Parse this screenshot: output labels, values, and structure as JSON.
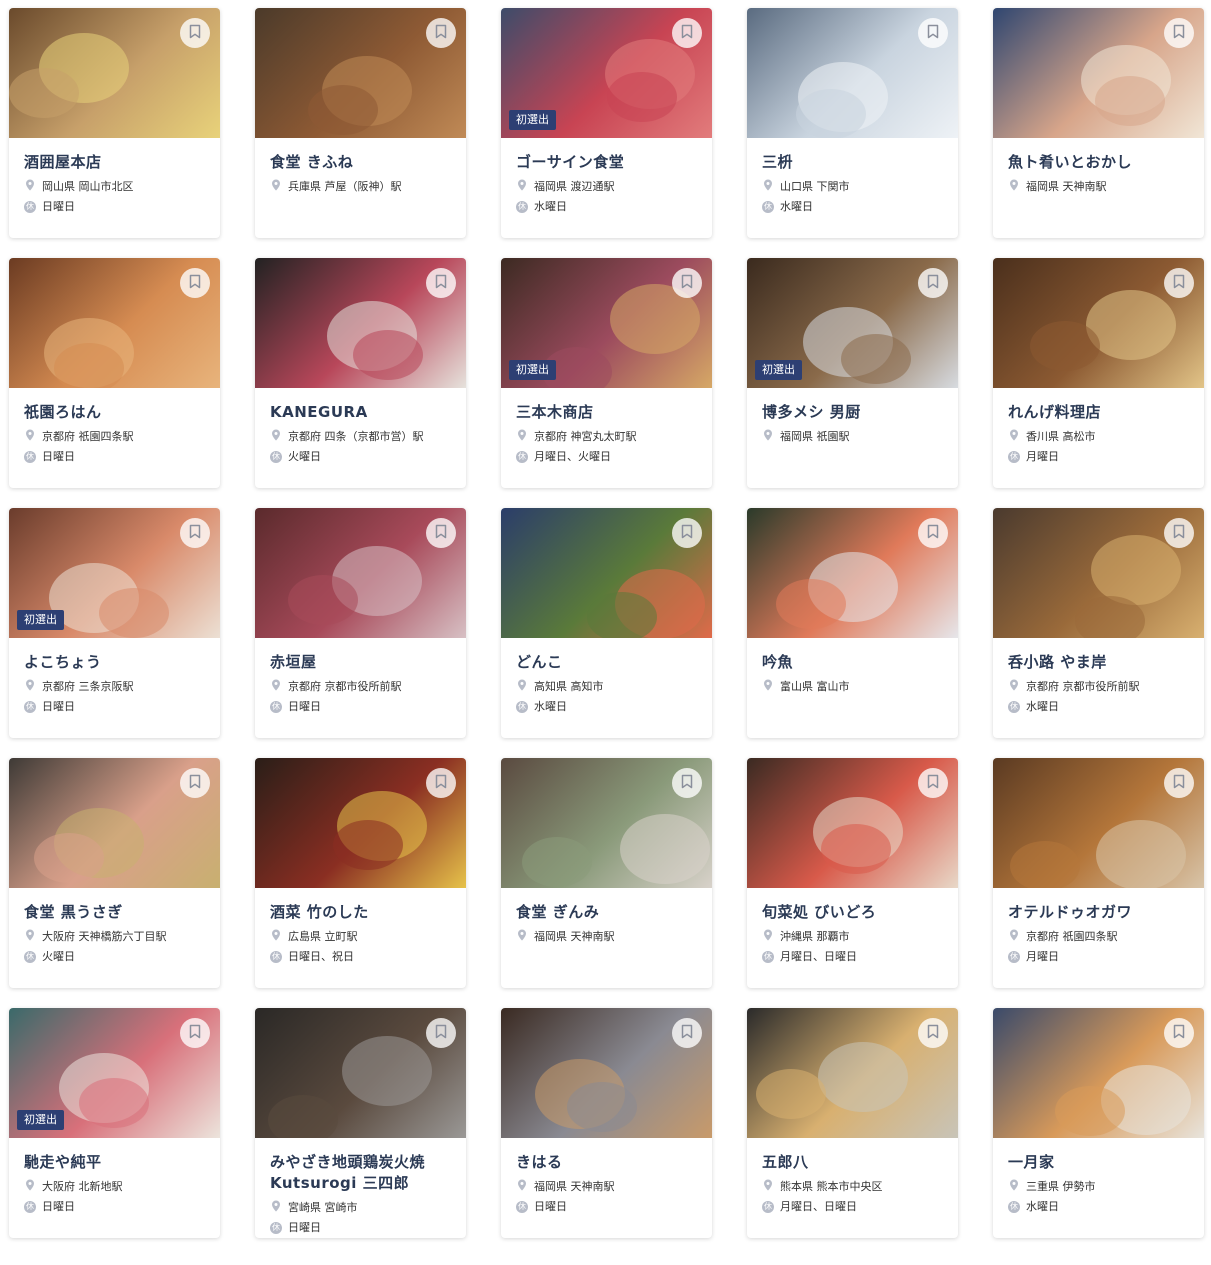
{
  "badge_label": "初選出",
  "restaurants": [
    {
      "name": "酒囲屋本店",
      "location": "岡山県 岡山市北区",
      "closed": "日曜日",
      "badge": false,
      "colors": [
        "#6a4a2c",
        "#c7a06a",
        "#e8d27a"
      ]
    },
    {
      "name": "食堂 きふね",
      "location": "兵庫県 芦屋（阪神）駅",
      "closed": "",
      "badge": false,
      "colors": [
        "#4b3a2a",
        "#8e5a34",
        "#c08a56"
      ]
    },
    {
      "name": "ゴーサイン食堂",
      "location": "福岡県 渡辺通駅",
      "closed": "水曜日",
      "badge": true,
      "colors": [
        "#3d4c6a",
        "#c84453",
        "#e27c7c"
      ]
    },
    {
      "name": "三枡",
      "location": "山口県 下関市",
      "closed": "水曜日",
      "badge": false,
      "colors": [
        "#5a6b80",
        "#c9d4df",
        "#eef2f6"
      ]
    },
    {
      "name": "魚ト肴いとおかし",
      "location": "福岡県 天神南駅",
      "closed": "",
      "badge": false,
      "colors": [
        "#2f4670",
        "#d7a58a",
        "#f1e6d6"
      ]
    },
    {
      "name": "祇園ろはん",
      "location": "京都府 祇園四条駅",
      "closed": "日曜日",
      "badge": false,
      "colors": [
        "#6b3b22",
        "#d68c52",
        "#e8b47c"
      ]
    },
    {
      "name": "KANEGURA",
      "location": "京都府 四条（京都市営）駅",
      "closed": "火曜日",
      "badge": false,
      "colors": [
        "#222222",
        "#b8475a",
        "#e6e2dc"
      ]
    },
    {
      "name": "三本木商店",
      "location": "京都府 神宮丸太町駅",
      "closed": "月曜日、火曜日",
      "badge": true,
      "colors": [
        "#3c2a22",
        "#9c4b5e",
        "#d6a866"
      ]
    },
    {
      "name": "博多メシ 男厨",
      "location": "福岡県 祇園駅",
      "closed": "",
      "badge": true,
      "colors": [
        "#3a2a1e",
        "#8a6a4a",
        "#d7dbe0"
      ]
    },
    {
      "name": "れんげ料理店",
      "location": "香川県 高松市",
      "closed": "月曜日",
      "badge": false,
      "colors": [
        "#4a2f1c",
        "#8c5a32",
        "#e2c488"
      ]
    },
    {
      "name": "よこちょう",
      "location": "京都府 三条京阪駅",
      "closed": "日曜日",
      "badge": true,
      "colors": [
        "#6a3c2c",
        "#d98a6a",
        "#ece0d4"
      ]
    },
    {
      "name": "赤垣屋",
      "location": "京都府 京都市役所前駅",
      "closed": "日曜日",
      "badge": false,
      "colors": [
        "#5a2a2c",
        "#a84a5a",
        "#d7c0c4"
      ]
    },
    {
      "name": "どんこ",
      "location": "高知県 高知市",
      "closed": "水曜日",
      "badge": false,
      "colors": [
        "#2b3d6a",
        "#5a7a3a",
        "#e06a4a"
      ]
    },
    {
      "name": "吟魚",
      "location": "富山県 富山市",
      "closed": "",
      "badge": false,
      "colors": [
        "#2a3a2a",
        "#e07a5a",
        "#e6e6ea"
      ]
    },
    {
      "name": "呑小路 やま岸",
      "location": "京都府 京都市役所前駅",
      "closed": "水曜日",
      "badge": false,
      "colors": [
        "#4a3a2e",
        "#9a6a3a",
        "#d8b070"
      ]
    },
    {
      "name": "食堂 黒うさぎ",
      "location": "大阪府 天神橋筋六丁目駅",
      "closed": "火曜日",
      "badge": false,
      "colors": [
        "#3e3a36",
        "#d9a08a",
        "#c8b070"
      ]
    },
    {
      "name": "酒菜 竹のした",
      "location": "広島県 立町駅",
      "closed": "日曜日、祝日",
      "badge": false,
      "colors": [
        "#2a1e18",
        "#8a2e22",
        "#e6c24a"
      ]
    },
    {
      "name": "食堂 ぎんみ",
      "location": "福岡県 天神南駅",
      "closed": "",
      "badge": false,
      "colors": [
        "#5a4a40",
        "#8a9a7a",
        "#d8d2ca"
      ]
    },
    {
      "name": "旬菜処 びいどろ",
      "location": "沖縄県 那覇市",
      "closed": "月曜日、日曜日",
      "badge": false,
      "colors": [
        "#3a2a22",
        "#d85a4a",
        "#e8d8c8"
      ]
    },
    {
      "name": "オテルドゥオガワ",
      "location": "京都府 祇園四条駅",
      "closed": "月曜日",
      "badge": false,
      "colors": [
        "#5a3a22",
        "#b4763a",
        "#d8c4a8"
      ]
    },
    {
      "name": "馳走や純平",
      "location": "大阪府 北新地駅",
      "closed": "日曜日",
      "badge": true,
      "colors": [
        "#3a6a6a",
        "#d8707a",
        "#ece4dc"
      ]
    },
    {
      "name": "みやざき地頭鶏炭火焼 Kutsurogi 三四郎",
      "location": "宮崎県 宮崎市",
      "closed": "日曜日",
      "badge": false,
      "colors": [
        "#2a2826",
        "#5a4a3e",
        "#9a9896"
      ]
    },
    {
      "name": "きはる",
      "location": "福岡県 天神南駅",
      "closed": "日曜日",
      "badge": false,
      "colors": [
        "#3a2a22",
        "#8a8a92",
        "#c89a6a"
      ]
    },
    {
      "name": "五郎八",
      "location": "熊本県 熊本市中央区",
      "closed": "月曜日、日曜日",
      "badge": false,
      "colors": [
        "#2a2a2a",
        "#d8b070",
        "#c8c4b8"
      ]
    },
    {
      "name": "一月家",
      "location": "三重県 伊勢市",
      "closed": "水曜日",
      "badge": false,
      "colors": [
        "#3a4a6a",
        "#d89a5a",
        "#e8e4dc"
      ]
    }
  ]
}
